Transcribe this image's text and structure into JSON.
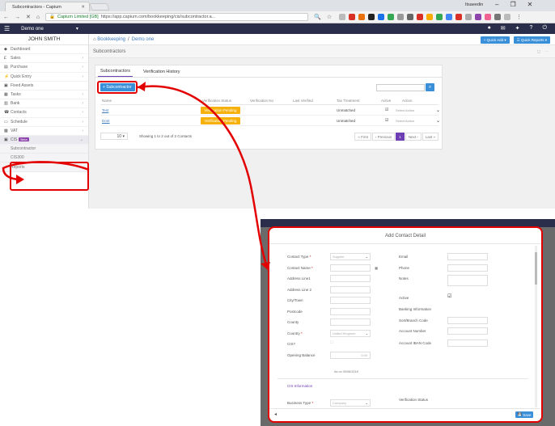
{
  "browser": {
    "tab_title": "Subcontractors - Capium",
    "user": "Itsaeedin",
    "secure_label": "Capium Limited [GB]",
    "url": "https://app.capium.com/bookkeeping/cis/subcontractor.a..."
  },
  "app": {
    "organisation": "Demo one",
    "user_name": "JOHN SMITH",
    "quick_add": "Quick Add",
    "quick_reports": "Quick Reports"
  },
  "sidebar": {
    "items": [
      {
        "icon": "dashboard-icon",
        "glyph": "◆",
        "label": "Dashboard"
      },
      {
        "icon": "currency-icon",
        "glyph": "£",
        "label": "Sales"
      },
      {
        "icon": "cart-icon",
        "glyph": "▤",
        "label": "Purchase"
      },
      {
        "icon": "lightning-icon",
        "glyph": "⚡",
        "label": "Quick Entry"
      },
      {
        "icon": "box-icon",
        "glyph": "▣",
        "label": "Fixed Assets"
      },
      {
        "icon": "tasks-icon",
        "glyph": "▦",
        "label": "Tasks"
      },
      {
        "icon": "bank-icon",
        "glyph": "▥",
        "label": "Bank"
      },
      {
        "icon": "contacts-icon",
        "glyph": "☎",
        "label": "Contacts"
      },
      {
        "icon": "calendar-icon",
        "glyph": "▭",
        "label": "Schedule"
      },
      {
        "icon": "vat-icon",
        "glyph": "▩",
        "label": "VAT"
      }
    ],
    "cis": {
      "label": "CIS",
      "badge": "Beta"
    },
    "cis_sub": [
      "Subcontractor",
      "CIS300",
      "Reports"
    ]
  },
  "breadcrumb": {
    "root": "Bookkeeping",
    "sep": "/",
    "current": "Demo one"
  },
  "page_title": "Subcontractors",
  "tabs": [
    "Subcontractors",
    "Verification History"
  ],
  "add_button": "+ Subcontractor",
  "table": {
    "headers": [
      "Name",
      "Verification Status",
      "Verification No",
      "Last Verified",
      "Tax Treatment",
      "Active",
      "Action"
    ],
    "rows": [
      {
        "name": "Test",
        "status": "Verification Pending",
        "tax": "Unmatched",
        "action": "Select Action"
      },
      {
        "name": "Dont",
        "status": "Verification Pending",
        "tax": "Unmatched",
        "action": "Select Action"
      }
    ]
  },
  "pager": {
    "size": "10",
    "showing": "Showing 1 to 2 out of 2 Contacts",
    "buttons": [
      "« First",
      "‹ Previous",
      "1",
      "Next ›",
      "Last »"
    ]
  },
  "modal": {
    "title": "Add Contact Detail",
    "left_fields": [
      {
        "label": "Contact Type",
        "required": true,
        "value": "Supplier",
        "kind": "select"
      },
      {
        "label": "Contact Name",
        "required": true,
        "value": "",
        "kind": "input"
      },
      {
        "label": "Address Line1",
        "required": false,
        "value": "",
        "kind": "input"
      },
      {
        "label": "Address Line 2",
        "required": false,
        "value": "",
        "kind": "input"
      },
      {
        "label": "City/Town",
        "required": false,
        "value": "",
        "kind": "input"
      },
      {
        "label": "Postcode",
        "required": false,
        "value": "",
        "kind": "input"
      },
      {
        "label": "County",
        "required": false,
        "value": "",
        "kind": "input"
      },
      {
        "label": "Country",
        "required": true,
        "value": "United Kingdom",
        "kind": "select"
      },
      {
        "label": "CIS?",
        "required": false,
        "value": "",
        "kind": "checkbox"
      },
      {
        "label": "Opening Balance",
        "required": false,
        "value": "0.00",
        "kind": "input"
      }
    ],
    "as_on": "As on 30/06/2018",
    "right_fields": [
      {
        "label": "Email"
      },
      {
        "label": "Phone"
      },
      {
        "label": "Notes"
      },
      {
        "label": "Active"
      },
      {
        "label": "Banking Information"
      },
      {
        "label": "Sort/Branch Code"
      },
      {
        "label": "Account Number"
      },
      {
        "label": "Account IBAN Code"
      }
    ],
    "cis_section": "CIS Information",
    "business_type": {
      "label": "Business Type",
      "value": "Company"
    },
    "verification_status": "Verification Status",
    "save": "Save"
  }
}
